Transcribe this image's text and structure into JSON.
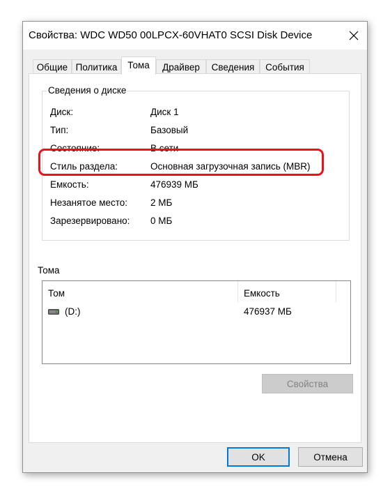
{
  "window": {
    "title": "Свойства: WDC WD50 00LPCX-60VHAT0 SCSI Disk Device"
  },
  "tabs": [
    "Общие",
    "Политика",
    "Тома",
    "Драйвер",
    "Сведения",
    "События"
  ],
  "active_tab": "Тома",
  "disk_info": {
    "group_title": "Сведения о диске",
    "rows": [
      {
        "label": "Диск:",
        "value": "Диск 1"
      },
      {
        "label": "Тип:",
        "value": "Базовый"
      },
      {
        "label": "Состояние:",
        "value": "В сети"
      },
      {
        "label": "Стиль раздела:",
        "value": "Основная загрузочная запись (MBR)"
      },
      {
        "label": "Емкость:",
        "value": "476939 МБ"
      },
      {
        "label": "Незанятое место:",
        "value": "2 МБ"
      },
      {
        "label": "Зарезервировано:",
        "value": "0 МБ"
      }
    ]
  },
  "volumes": {
    "heading": "Тома",
    "columns": [
      "Том",
      "Емкость"
    ],
    "rows": [
      {
        "volume": "(D:)",
        "capacity": "476937 МБ",
        "icon": "drive-icon"
      }
    ]
  },
  "buttons": {
    "properties": "Свойства",
    "ok": "OK",
    "cancel": "Отмена"
  },
  "colors": {
    "highlight_border": "#e8131a",
    "focus_border": "#0078d7"
  }
}
